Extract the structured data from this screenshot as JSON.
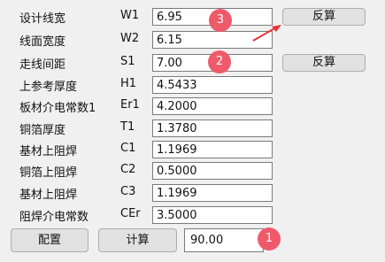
{
  "rows": [
    {
      "label": "设计线宽",
      "symbol": "W1",
      "value": "6.95"
    },
    {
      "label": "线面宽度",
      "symbol": "W2",
      "value": "6.15"
    },
    {
      "label": "走线间距",
      "symbol": "S1",
      "value": "7.00"
    },
    {
      "label": "上参考厚度",
      "symbol": "H1",
      "value": "4.5433"
    },
    {
      "label": "板材介电常数1",
      "symbol": "Er1",
      "value": "4.2000"
    },
    {
      "label": "铜箔厚度",
      "symbol": "T1",
      "value": "1.3780"
    },
    {
      "label": "基材上阻焊",
      "symbol": "C1",
      "value": "1.1969"
    },
    {
      "label": "铜箔上阻焊",
      "symbol": "C2",
      "value": "0.5000"
    },
    {
      "label": "基材上阻焊",
      "symbol": "C3",
      "value": "1.1969"
    },
    {
      "label": "阻焊介电常数",
      "symbol": "CEr",
      "value": "3.5000"
    }
  ],
  "buttons": {
    "reverse_w1": "反算",
    "reverse_s1": "反算",
    "config": "配置",
    "calculate": "计算"
  },
  "result": {
    "value": "90.00"
  },
  "badges": {
    "one": "1",
    "two": "2",
    "three": "3"
  },
  "colors": {
    "badge": "#ef5a6a",
    "arrow": "#e8343b"
  }
}
